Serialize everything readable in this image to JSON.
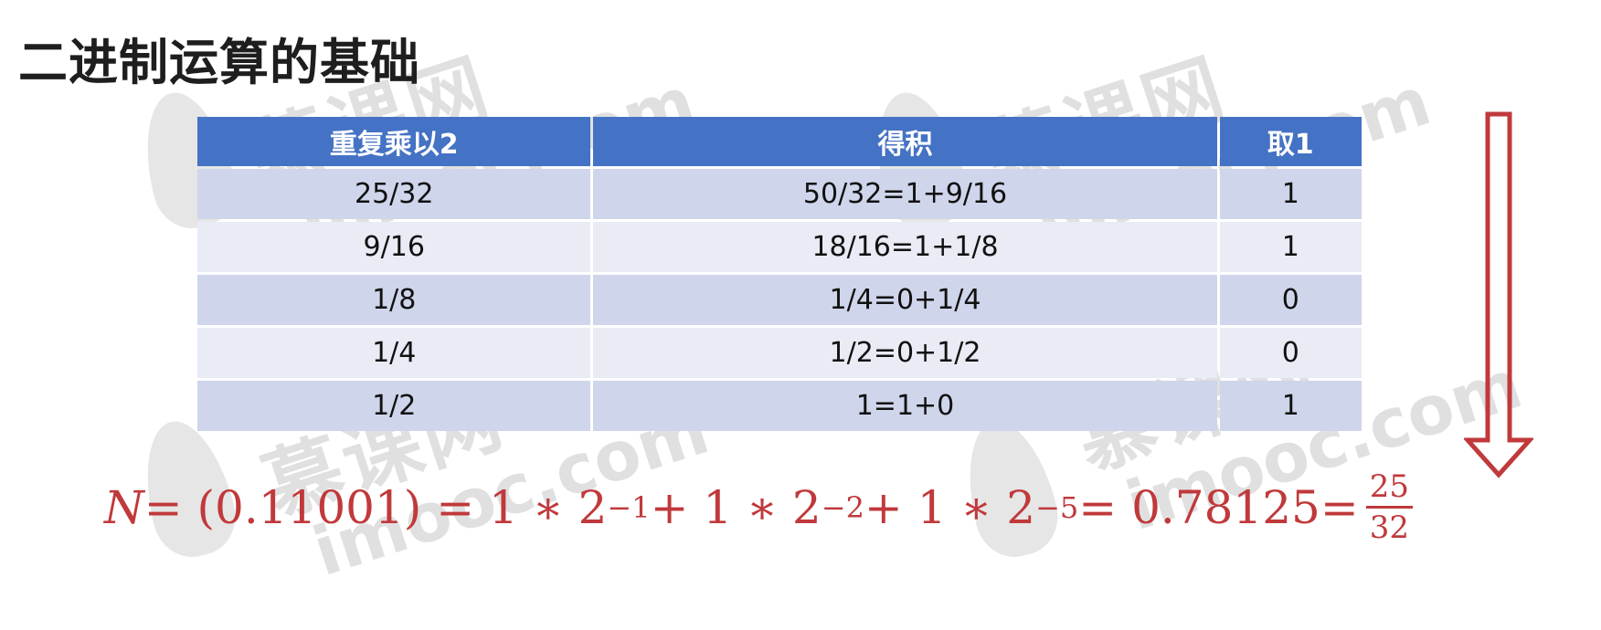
{
  "title": "二进制运算的基础",
  "watermark": {
    "cn": "慕课网",
    "en": "imooc.com"
  },
  "table": {
    "headers": [
      "重复乘以2",
      "得积",
      "取1"
    ],
    "rows": [
      [
        "25/32",
        "50/32=1+9/16",
        "1"
      ],
      [
        "9/16",
        "18/16=1+1/8",
        "1"
      ],
      [
        "1/8",
        "1/4=0+1/4",
        "0"
      ],
      [
        "1/4",
        "1/2=0+1/2",
        "0"
      ],
      [
        "1/2",
        "1=1+0",
        "1"
      ]
    ]
  },
  "formula": {
    "var": "N",
    "eq1": " = (0.11001) = 1 ∗ 2",
    "exp1": "−1",
    "mid1": " + 1 ∗ 2",
    "exp2": "−2",
    "mid2": " + 1 ∗ 2",
    "exp3": "−5",
    "tail": " = 0.78125=",
    "frac_num": "25",
    "frac_den": "32"
  },
  "colors": {
    "header_bg": "#4472c4",
    "row_odd": "#cfd5ea",
    "row_even": "#e9ebf5",
    "accent_red": "#c0393b"
  },
  "icons": {
    "arrow": "down-arrow-icon"
  }
}
